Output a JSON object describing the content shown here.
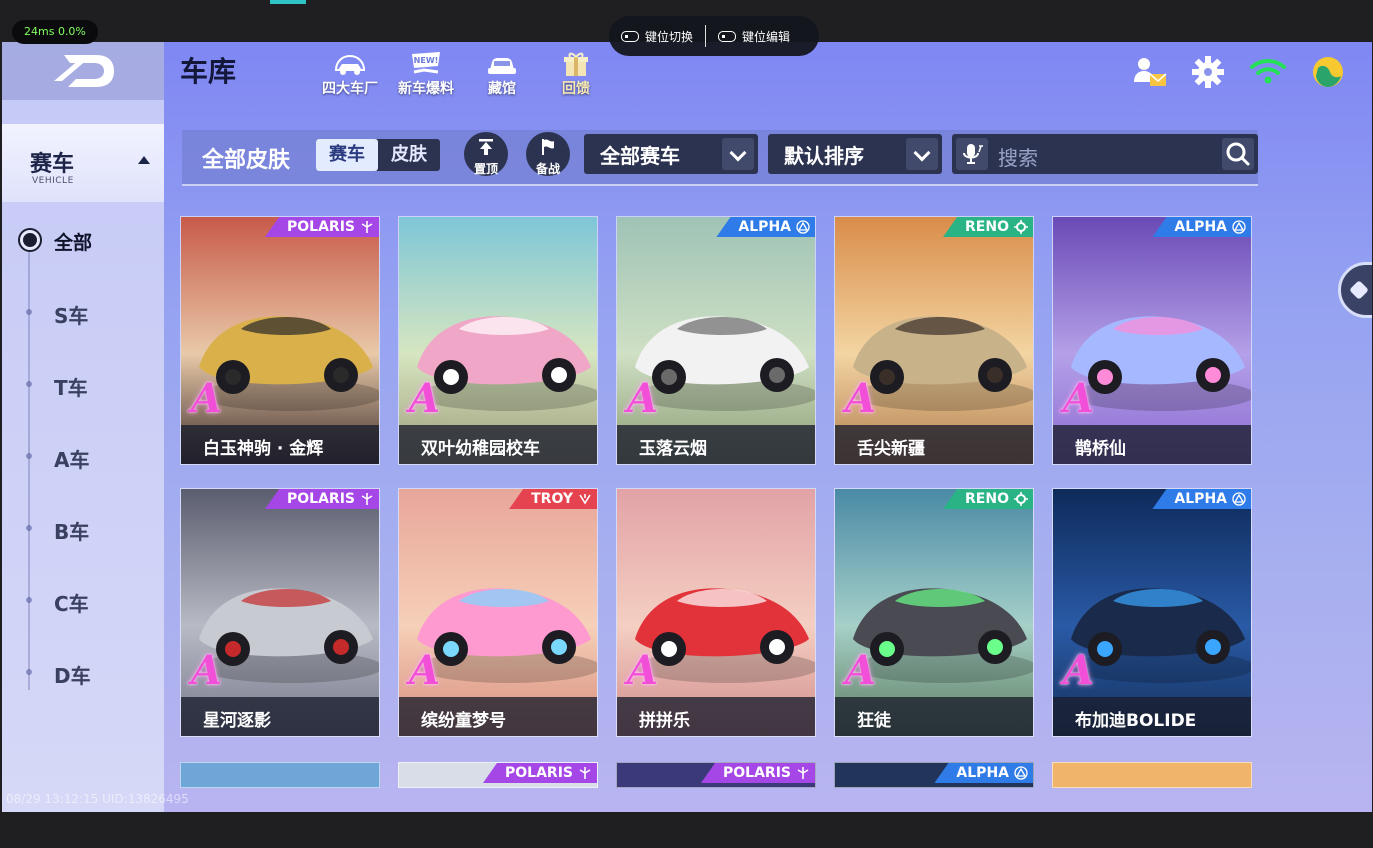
{
  "overlay": {
    "perf_text": "24ms  0.0%",
    "key_switch_label": "键位切换",
    "key_edit_label": "键位编辑",
    "watermark": "08/29 13:12:15 UID:13826495"
  },
  "header": {
    "title": "车库",
    "nav": [
      {
        "label": "四大车厂",
        "icon": "car-factory-icon"
      },
      {
        "label": "新车爆料",
        "icon": "new-badge-icon"
      },
      {
        "label": "藏馆",
        "icon": "collection-car-icon"
      },
      {
        "label": "回馈",
        "icon": "gift-icon"
      }
    ],
    "right_icons": [
      "friends-mail-icon",
      "gear-icon",
      "wifi-icon",
      "avatar-icon"
    ]
  },
  "sidebar": {
    "category": {
      "label": "赛车",
      "sub": "VEHICLE"
    },
    "classes": [
      {
        "label": "全部",
        "active": true
      },
      {
        "label": "S车",
        "active": false
      },
      {
        "label": "T车",
        "active": false
      },
      {
        "label": "A车",
        "active": false
      },
      {
        "label": "B车",
        "active": false
      },
      {
        "label": "C车",
        "active": false
      },
      {
        "label": "D车",
        "active": false
      }
    ]
  },
  "filter": {
    "title": "全部皮肤",
    "toggle": {
      "selected": "赛车",
      "other": "皮肤"
    },
    "pin_label": "置顶",
    "ready_label": "备战",
    "car_filter": "全部赛车",
    "sort": "默认排序",
    "search_placeholder": "搜索"
  },
  "cars": [
    {
      "name": "白玉神驹 · 金辉",
      "brand": "POLARIS",
      "grade": "A"
    },
    {
      "name": "双叶幼稚园校车",
      "brand": "",
      "grade": "A"
    },
    {
      "name": "玉落云烟",
      "brand": "ALPHA",
      "grade": "A"
    },
    {
      "name": "舌尖新疆",
      "brand": "RENO",
      "grade": "A"
    },
    {
      "name": "鹊桥仙",
      "brand": "ALPHA",
      "grade": "A"
    },
    {
      "name": "星河逐影",
      "brand": "POLARIS",
      "grade": "A"
    },
    {
      "name": "缤纷童梦号",
      "brand": "TROY",
      "grade": "A"
    },
    {
      "name": "拼拼乐",
      "brand": "",
      "grade": "A"
    },
    {
      "name": "狂徒",
      "brand": "RENO",
      "grade": "A"
    },
    {
      "name": "布加迪BOLIDE",
      "brand": "ALPHA",
      "grade": "A"
    }
  ],
  "partial_row_brands": [
    "",
    "POLARIS",
    "POLARIS",
    "ALPHA",
    ""
  ],
  "colors": {
    "polaris": "#a547e6",
    "alpha": "#2f7be8",
    "reno": "#2ab384",
    "troy": "#e4434f",
    "grade": "#f24fd8"
  }
}
